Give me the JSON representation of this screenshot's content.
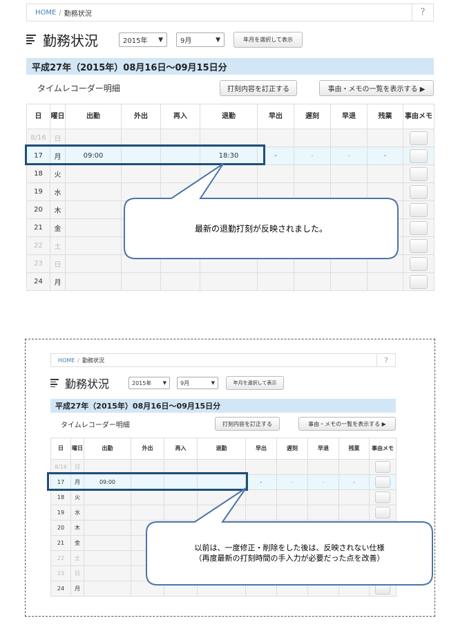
{
  "breadcrumb": {
    "home": "HOME",
    "separator": "/",
    "current": "勤務状況",
    "help": "?"
  },
  "header": {
    "title": "勤務状況",
    "year_select": "2015年",
    "month_select": "9月",
    "show_button": "年月を選択して表示"
  },
  "period_title": "平成27年（2015年）08月16日～09月15日分",
  "section_title": "タイムレコーダー明細",
  "correct_button": "打刻内容を訂正する",
  "list_button": "事由・メモの一覧を表示する ▶",
  "columns": [
    "日",
    "曜日",
    "出勤",
    "外出",
    "再入",
    "退勤",
    "早出",
    "遅刻",
    "早退",
    "残業",
    "事由メモ"
  ],
  "top_rows": [
    {
      "day": "8/16",
      "dow": "日",
      "in": "",
      "out": "",
      "re": "",
      "leave": "",
      "early": "",
      "late": "",
      "eleave": "",
      "over": "",
      "dim": true
    },
    {
      "day": "17",
      "dow": "月",
      "in": "09:00",
      "out": "",
      "re": "",
      "leave": "18:30",
      "early": "-",
      "late": "-",
      "eleave": "-",
      "over": "-",
      "hl": true
    },
    {
      "day": "18",
      "dow": "火",
      "in": "",
      "out": "",
      "re": "",
      "leave": "",
      "early": "",
      "late": "",
      "eleave": "",
      "over": ""
    },
    {
      "day": "19",
      "dow": "水",
      "in": "",
      "out": "",
      "re": "",
      "leave": "",
      "early": "",
      "late": "",
      "eleave": "",
      "over": ""
    },
    {
      "day": "20",
      "dow": "木",
      "in": "",
      "out": "",
      "re": "",
      "leave": "",
      "early": "",
      "late": "",
      "eleave": "",
      "over": ""
    },
    {
      "day": "21",
      "dow": "金",
      "in": "",
      "out": "",
      "re": "",
      "leave": "",
      "early": "",
      "late": "",
      "eleave": "",
      "over": ""
    },
    {
      "day": "22",
      "dow": "土",
      "in": "",
      "out": "",
      "re": "",
      "leave": "",
      "early": "",
      "late": "",
      "eleave": "",
      "over": "",
      "dim": true
    },
    {
      "day": "23",
      "dow": "日",
      "in": "",
      "out": "",
      "re": "",
      "leave": "",
      "early": "",
      "late": "",
      "eleave": "",
      "over": "",
      "dim": true
    },
    {
      "day": "24",
      "dow": "月",
      "in": "",
      "out": "",
      "re": "",
      "leave": "",
      "early": "",
      "late": "",
      "eleave": "",
      "over": ""
    }
  ],
  "bottom_rows": [
    {
      "day": "8/16",
      "dow": "日",
      "in": "",
      "out": "",
      "re": "",
      "leave": "",
      "early": "",
      "late": "",
      "eleave": "",
      "over": "",
      "dim": true
    },
    {
      "day": "17",
      "dow": "月",
      "in": "09:00",
      "out": "",
      "re": "",
      "leave": "",
      "early": "-",
      "late": "-",
      "eleave": "-",
      "over": "-",
      "hl": true
    },
    {
      "day": "18",
      "dow": "火",
      "in": "",
      "out": "",
      "re": "",
      "leave": "",
      "early": "",
      "late": "",
      "eleave": "",
      "over": ""
    },
    {
      "day": "19",
      "dow": "水",
      "in": "",
      "out": "",
      "re": "",
      "leave": "",
      "early": "",
      "late": "",
      "eleave": "",
      "over": ""
    },
    {
      "day": "20",
      "dow": "木",
      "in": "",
      "out": "",
      "re": "",
      "leave": "",
      "early": "",
      "late": "",
      "eleave": "",
      "over": ""
    },
    {
      "day": "21",
      "dow": "金",
      "in": "",
      "out": "",
      "re": "",
      "leave": "",
      "early": "",
      "late": "",
      "eleave": "",
      "over": ""
    },
    {
      "day": "22",
      "dow": "土",
      "in": "",
      "out": "",
      "re": "",
      "leave": "",
      "early": "",
      "late": "",
      "eleave": "",
      "over": "",
      "dim": true
    },
    {
      "day": "23",
      "dow": "日",
      "in": "",
      "out": "",
      "re": "",
      "leave": "",
      "early": "",
      "late": "",
      "eleave": "",
      "over": "",
      "dim": true
    },
    {
      "day": "24",
      "dow": "月",
      "in": "",
      "out": "",
      "re": "",
      "leave": "",
      "early": "",
      "late": "",
      "eleave": "",
      "over": ""
    }
  ],
  "callout_top": "最新の退勤打刻が反映されました。",
  "callout_bottom": [
    "以前は、一度修正・削除をした後は、反映されない仕様",
    "（再度最新の打刻時間の手入力が必要だった点を改善）"
  ],
  "colors": {
    "link": "#3a7fbf",
    "period_bg": "#d2e6f5",
    "highlight_row": "#eaf7fd",
    "frame": "#1f4e79",
    "callout_stroke": "#4a74a8"
  }
}
